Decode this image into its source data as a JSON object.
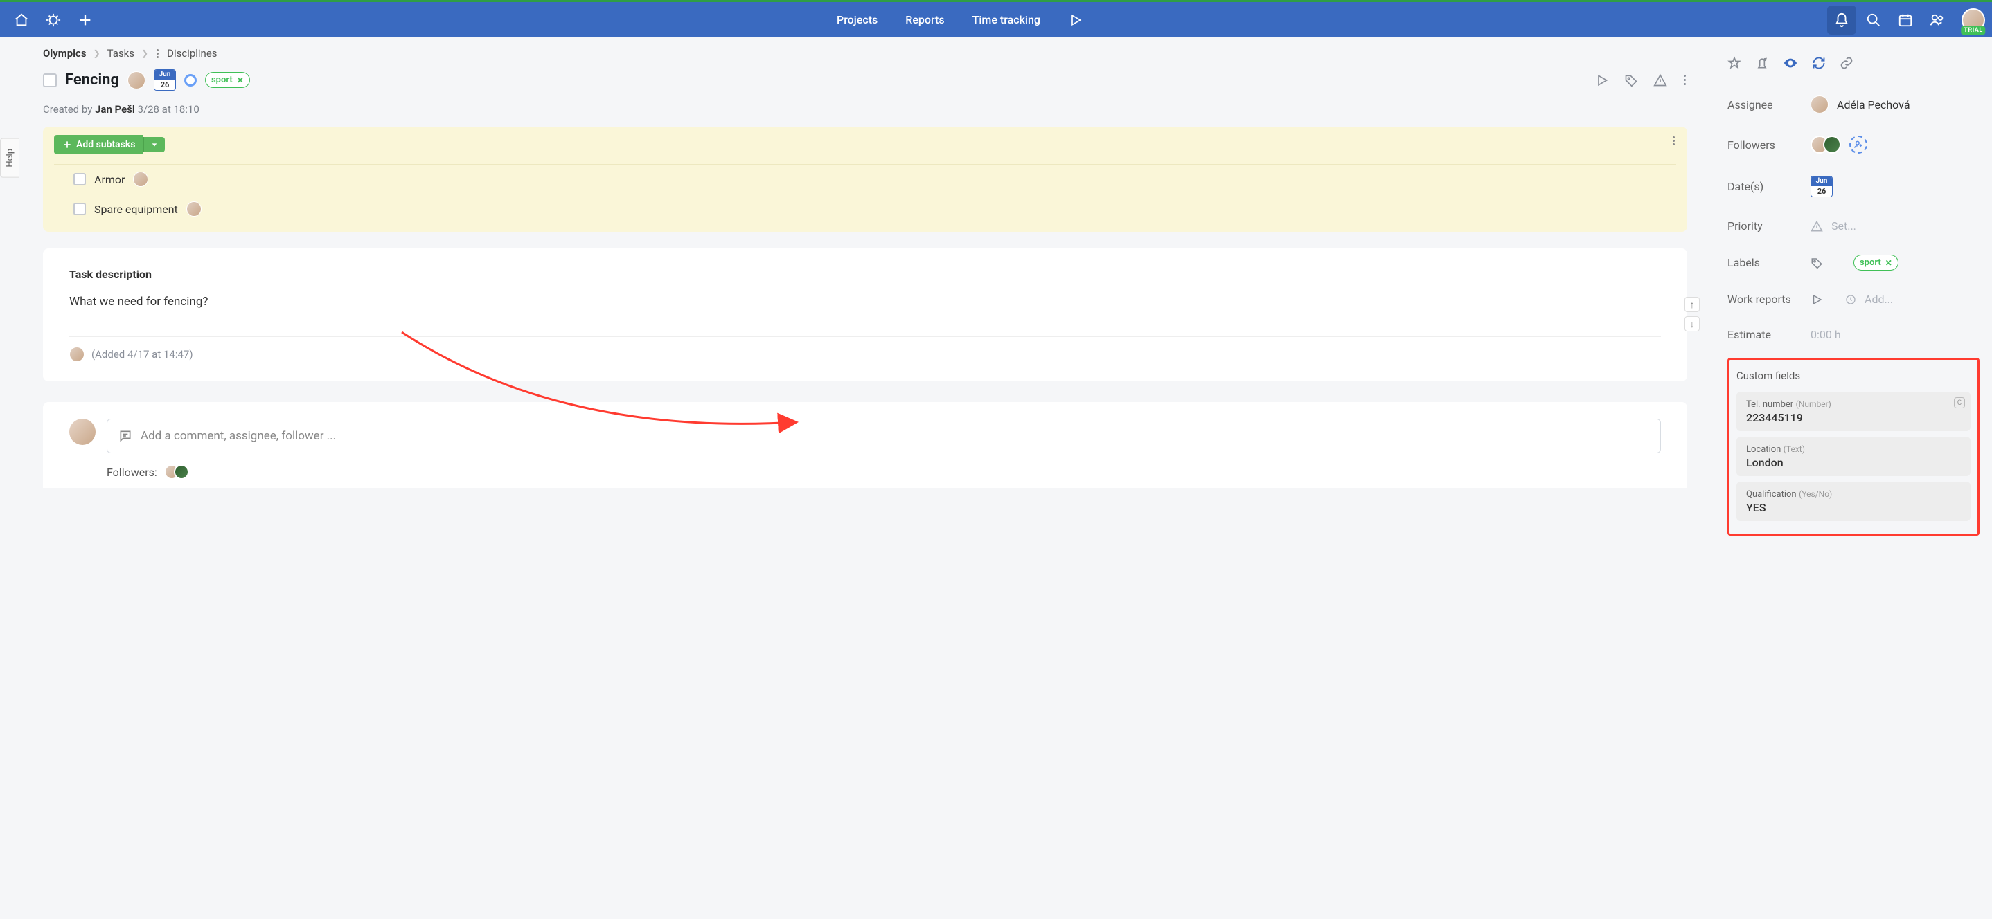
{
  "topbar": {
    "nav": {
      "projects": "Projects",
      "reports": "Reports",
      "time_tracking": "Time tracking"
    },
    "trial_label": "TRIAL"
  },
  "help_label": "Help",
  "breadcrumb": {
    "project": "Olympics",
    "section": "Tasks",
    "page": "Disciplines"
  },
  "task": {
    "title": "Fencing",
    "date": {
      "month": "Jun",
      "day": "26"
    },
    "tag": "sport",
    "created_prefix": "Created by ",
    "created_by": "Jan Pešl",
    "created_at": " 3/28 at 18:10"
  },
  "subtasks": {
    "add_label": "Add subtasks",
    "items": [
      {
        "title": "Armor"
      },
      {
        "title": "Spare equipment"
      }
    ]
  },
  "description": {
    "heading": "Task description",
    "text": "What we need for fencing?",
    "added": "(Added 4/17 at 14:47)"
  },
  "comment": {
    "placeholder": "Add a comment, assignee, follower ...",
    "followers_label": "Followers:"
  },
  "sidebar": {
    "assignee": {
      "label": "Assignee",
      "name": "Adéla Pechová"
    },
    "followers": {
      "label": "Followers"
    },
    "dates": {
      "label": "Date(s)",
      "month": "Jun",
      "day": "26"
    },
    "priority": {
      "label": "Priority",
      "placeholder": "Set..."
    },
    "labels": {
      "label": "Labels",
      "tag": "sport"
    },
    "work_reports": {
      "label": "Work reports",
      "placeholder": "Add..."
    },
    "estimate": {
      "label": "Estimate",
      "value": "0:00 h"
    },
    "custom_fields": {
      "heading": "Custom fields",
      "items": [
        {
          "label": "Tel. number",
          "type": "(Number)",
          "value": "223445119",
          "badge": "C"
        },
        {
          "label": "Location",
          "type": "(Text)",
          "value": "London"
        },
        {
          "label": "Qualification",
          "type": "(Yes/No)",
          "value": "YES"
        }
      ]
    }
  }
}
